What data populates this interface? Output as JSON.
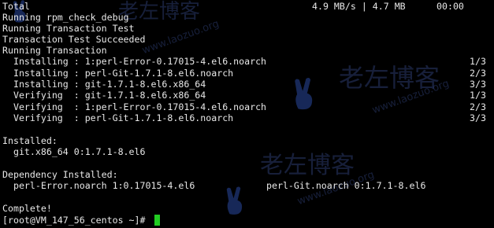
{
  "terminal": {
    "header_row": {
      "label": "Total",
      "speed": "4.9 MB/s | 4.7 MB",
      "time": "00:00"
    },
    "lines": [
      "Running rpm_check_debug",
      "Running Transaction Test",
      "Transaction Test Succeeded",
      "Running Transaction"
    ],
    "transactions": [
      {
        "text": "  Installing : 1:perl-Error-0.17015-4.el6.noarch",
        "count": "1/3"
      },
      {
        "text": "  Installing : perl-Git-1.7.1-8.el6.noarch",
        "count": "2/3"
      },
      {
        "text": "  Installing : git-1.7.1-8.el6.x86_64",
        "count": "3/3"
      },
      {
        "text": "  Verifying  : git-1.7.1-8.el6.x86_64",
        "count": "1/3"
      },
      {
        "text": "  Verifying  : 1:perl-Error-0.17015-4.el6.noarch",
        "count": "2/3"
      },
      {
        "text": "  Verifying  : perl-Git-1.7.1-8.el6.noarch",
        "count": "3/3"
      }
    ],
    "installed_header": "Installed:",
    "installed_pkg": "  git.x86_64 0:1.7.1-8.el6",
    "dependency_header": "Dependency Installed:",
    "dependency_pkg_1": "  perl-Error.noarch 1:0.17015-4.el6",
    "dependency_pkg_2": "perl-Git.noarch 0:1.7.1-8.el6",
    "complete": "Complete!",
    "prompt": "[root@VM_147_56_centos ~]#",
    "cursor_color": "#22cc22"
  },
  "watermark": {
    "brand_cn": "老左博客",
    "brand_url": "www.laozuo.org",
    "icon": "victory-hand-icon"
  }
}
